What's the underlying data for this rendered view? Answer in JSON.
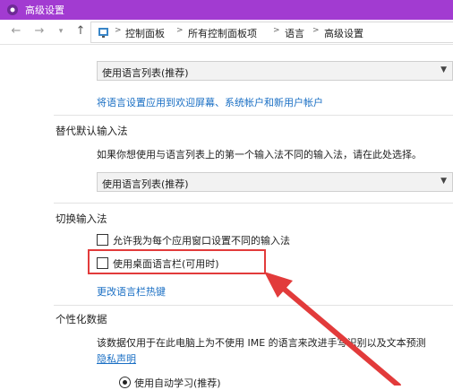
{
  "window": {
    "title": "高级设置",
    "accent_color": "#a23bd1"
  },
  "nav": {
    "back_icon": "back-arrow-icon",
    "forward_icon": "forward-arrow-icon",
    "dropdown_icon": "chevron-down-icon",
    "up_icon": "up-arrow-icon",
    "breadcrumbs": [
      "控制面板",
      "所有控制面板项",
      "语言",
      "高级设置"
    ]
  },
  "override_display": {
    "dropdown_value": "使用语言列表(推荐)",
    "apply_link": "将语言设置应用到欢迎屏幕、系统帐户和新用户帐户"
  },
  "default_input": {
    "heading": "替代默认输入法",
    "description": "如果你想使用与语言列表上的第一个输入法不同的输入法，请在此处选择。",
    "dropdown_value": "使用语言列表(推荐)"
  },
  "switching": {
    "heading": "切换输入法",
    "option1": "允许我为每个应用窗口设置不同的输入法",
    "option1_checked": false,
    "option2": "使用桌面语言栏(可用时)",
    "option2_checked": false,
    "hotkeys_link": "更改语言栏热键"
  },
  "personalization": {
    "heading": "个性化数据",
    "description": "该数据仅用于在此电脑上为不使用 IME 的语言来改进手写识别以及文本预测",
    "privacy_link": "隐私声明",
    "radio_label": "使用自动学习(推荐)"
  },
  "annotation_color": "#e23b3b"
}
